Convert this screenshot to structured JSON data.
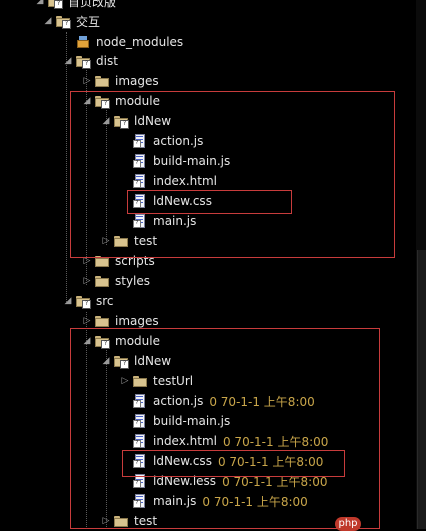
{
  "tree": [
    {
      "label": "首页改版",
      "type": "folder",
      "expanded": true
    },
    {
      "label": "交互",
      "type": "folder",
      "expanded": true
    },
    {
      "label": "node_modules",
      "type": "library"
    },
    {
      "label": "dist",
      "type": "folder",
      "expanded": true
    },
    {
      "label": "images",
      "type": "folder"
    },
    {
      "label": "module",
      "type": "folder",
      "expanded": true
    },
    {
      "label": "ldNew",
      "type": "folder",
      "expanded": true
    },
    {
      "label": "action.js",
      "type": "file"
    },
    {
      "label": "build-main.js",
      "type": "file"
    },
    {
      "label": "index.html",
      "type": "file"
    },
    {
      "label": "ldNew.css",
      "type": "file"
    },
    {
      "label": "main.js",
      "type": "file"
    },
    {
      "label": "test",
      "type": "folder"
    },
    {
      "label": "scripts",
      "type": "folder"
    },
    {
      "label": "styles",
      "type": "folder"
    },
    {
      "label": "src",
      "type": "folder",
      "expanded": true
    },
    {
      "label": "images",
      "type": "folder"
    },
    {
      "label": "module",
      "type": "folder",
      "expanded": true
    },
    {
      "label": "ldNew",
      "type": "folder",
      "expanded": true
    },
    {
      "label": "testUrl",
      "type": "folder"
    },
    {
      "label": "action.js",
      "type": "file",
      "meta": "0  70-1-1 上午8:00"
    },
    {
      "label": "build-main.js",
      "type": "file"
    },
    {
      "label": "index.html",
      "type": "file",
      "meta": "0  70-1-1 上午8:00"
    },
    {
      "label": "ldNew.css",
      "type": "file",
      "meta": "0  70-1-1 上午8:00"
    },
    {
      "label": "ldNew.less",
      "type": "file",
      "meta": "0  70-1-1 上午8:00"
    },
    {
      "label": "main.js",
      "type": "file",
      "meta": "0  70-1-1 上午8:00"
    },
    {
      "label": "test",
      "type": "folder"
    }
  ],
  "watermark": "php",
  "colors": {
    "background": "#000000",
    "text": "#e6e6e6",
    "meta": "#c9a64a",
    "highlight": "#c83c3c"
  }
}
